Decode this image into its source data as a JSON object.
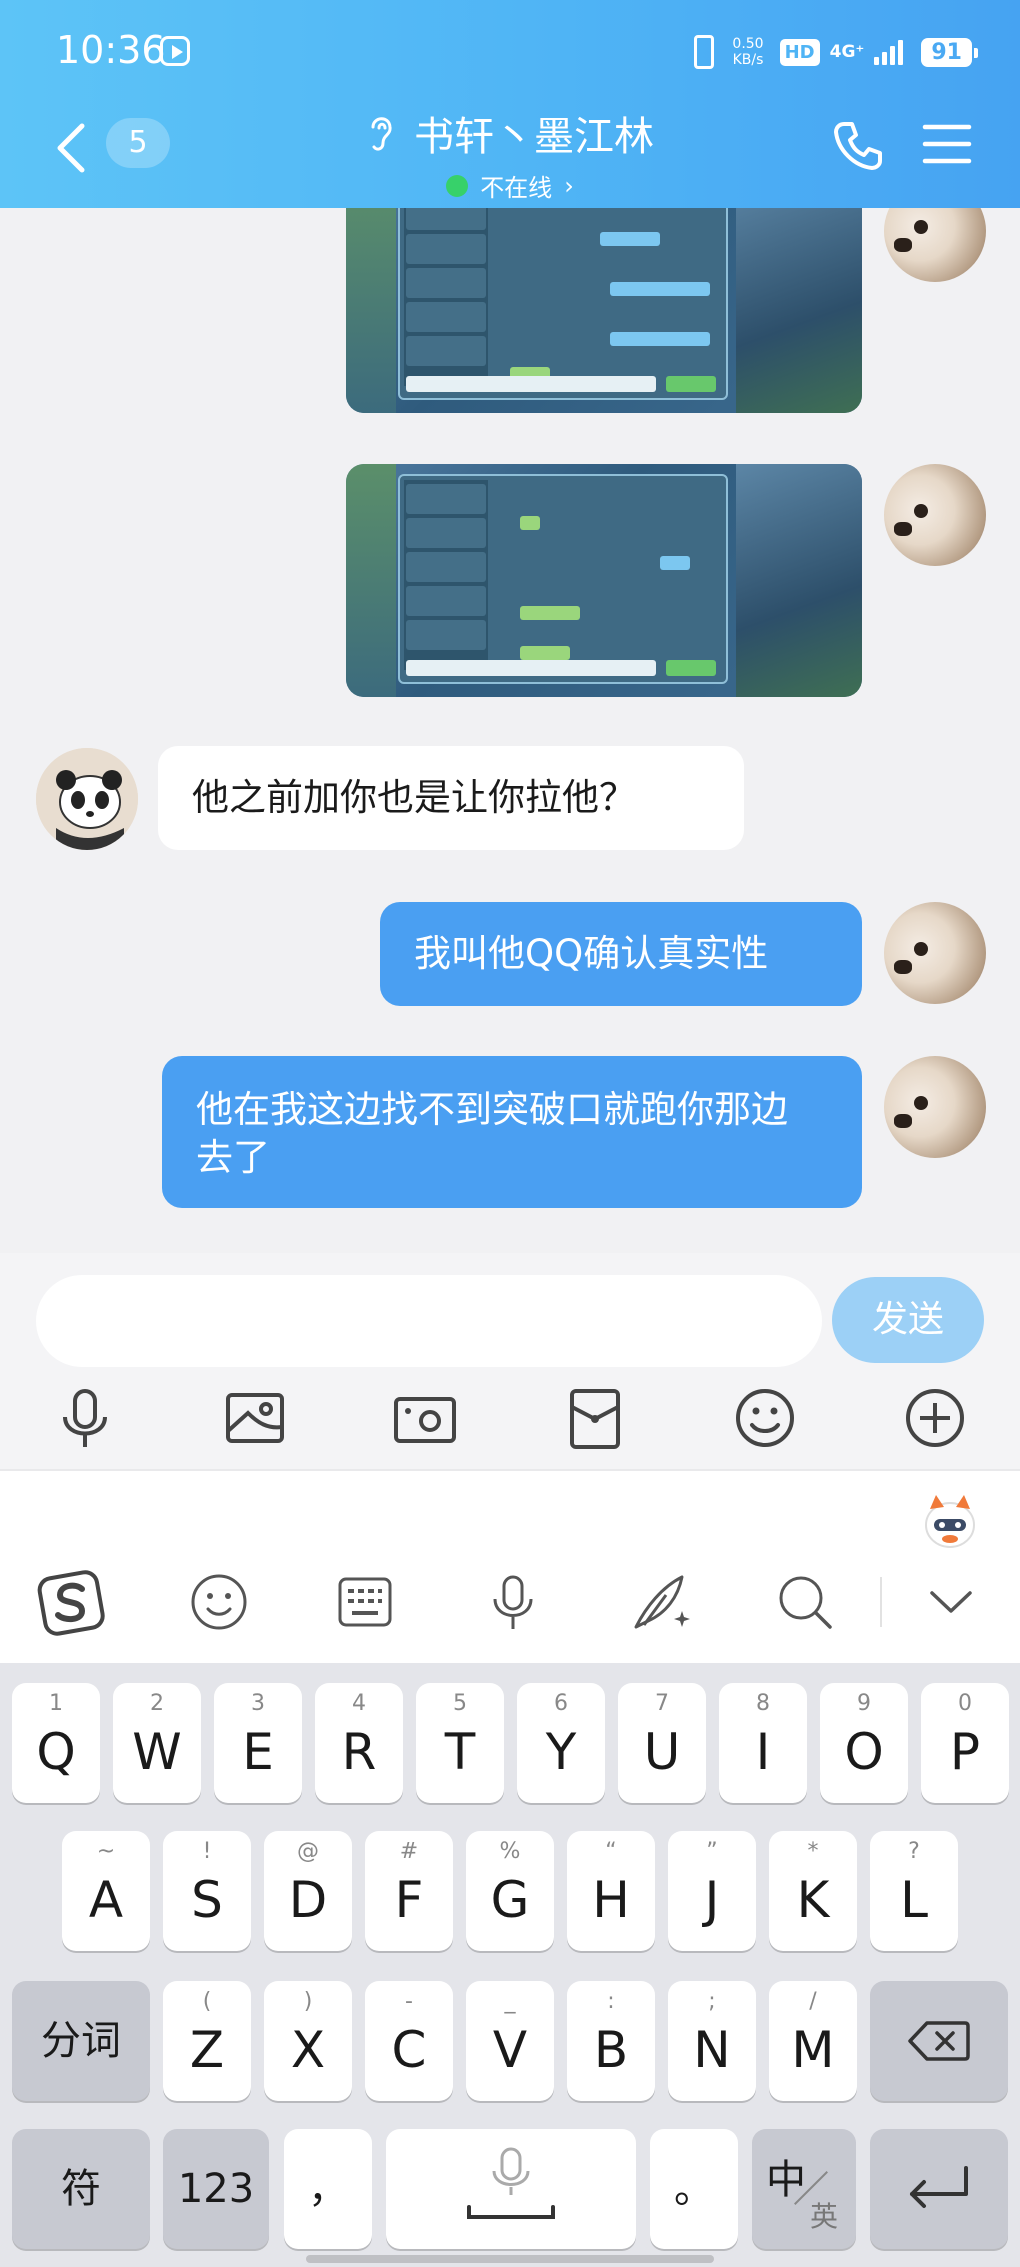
{
  "status_bar": {
    "time": "10:36",
    "speed_value": "0.50",
    "speed_unit": "KB/s",
    "hd": "HD",
    "network": "4G⁺",
    "battery": "91"
  },
  "header": {
    "unread_count": "5",
    "contact_name": "书轩丶墨江林",
    "presence": "不在线",
    "presence_chevron": "›",
    "status_color": "#37d16a"
  },
  "messages": [
    {
      "side": "out",
      "type": "image",
      "content": "game-screenshot"
    },
    {
      "side": "out",
      "type": "image",
      "content": "game-screenshot"
    },
    {
      "side": "in",
      "type": "text",
      "text": "他之前加你也是让你拉他？"
    },
    {
      "side": "out",
      "type": "text",
      "text": "我叫他QQ确认真实性"
    },
    {
      "side": "out",
      "type": "text",
      "text": "他在我这边找不到突破口就跑你那边去了"
    }
  ],
  "composer": {
    "placeholder": "",
    "send_label": "发送",
    "tools": [
      "microphone-icon",
      "image-icon",
      "camera-icon",
      "red-packet-icon",
      "emoji-icon",
      "plus-icon"
    ]
  },
  "ime": {
    "tools": [
      "sogou-logo-icon",
      "emoji-icon",
      "keyboard-icon",
      "voice-icon",
      "handwriting-icon",
      "search-icon",
      "collapse-icon"
    ]
  },
  "keyboard": {
    "row1": [
      {
        "hint": "1",
        "key": "Q"
      },
      {
        "hint": "2",
        "key": "W"
      },
      {
        "hint": "3",
        "key": "E"
      },
      {
        "hint": "4",
        "key": "R"
      },
      {
        "hint": "5",
        "key": "T"
      },
      {
        "hint": "6",
        "key": "Y"
      },
      {
        "hint": "7",
        "key": "U"
      },
      {
        "hint": "8",
        "key": "I"
      },
      {
        "hint": "9",
        "key": "O"
      },
      {
        "hint": "0",
        "key": "P"
      }
    ],
    "row2": [
      {
        "hint": "~",
        "key": "A"
      },
      {
        "hint": "!",
        "key": "S"
      },
      {
        "hint": "@",
        "key": "D"
      },
      {
        "hint": "#",
        "key": "F"
      },
      {
        "hint": "%",
        "key": "G"
      },
      {
        "hint": "“",
        "key": "H"
      },
      {
        "hint": "”",
        "key": "J"
      },
      {
        "hint": "*",
        "key": "K"
      },
      {
        "hint": "?",
        "key": "L"
      }
    ],
    "row3": [
      {
        "hint": "(",
        "key": "Z"
      },
      {
        "hint": ")",
        "key": "X"
      },
      {
        "hint": "-",
        "key": "C"
      },
      {
        "hint": "_",
        "key": "V"
      },
      {
        "hint": ":",
        "key": "B"
      },
      {
        "hint": ";",
        "key": "N"
      },
      {
        "hint": "/",
        "key": "M"
      }
    ],
    "segment_label": "分词",
    "symbol_label": "符",
    "number_label": "123",
    "comma_label": "，",
    "period_label": "。",
    "lang_primary": "中",
    "lang_secondary": "英"
  }
}
